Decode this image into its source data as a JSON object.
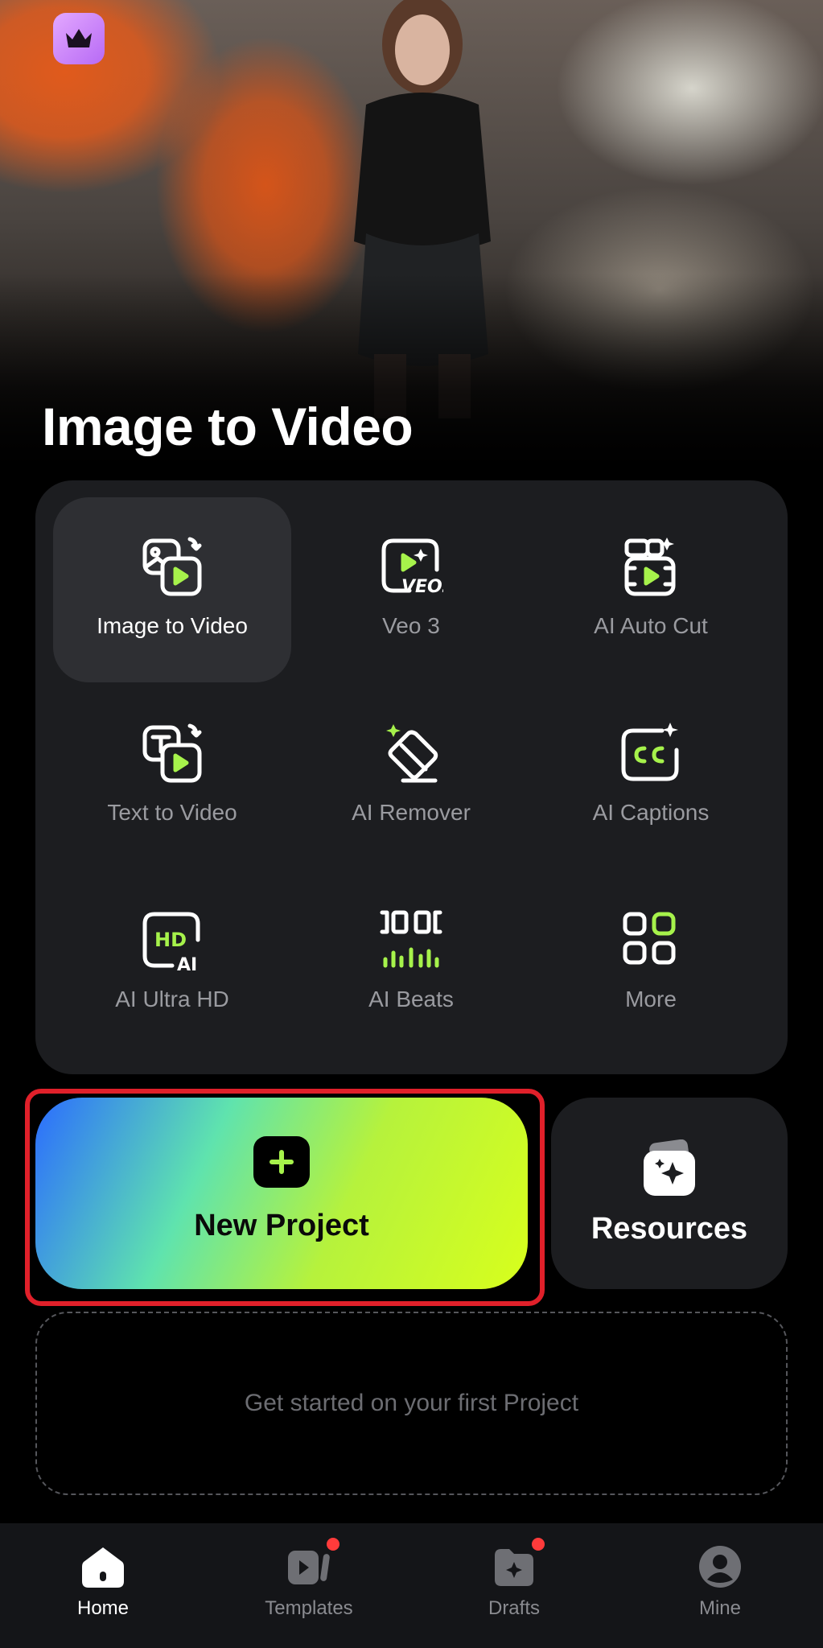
{
  "hero": {
    "title": "Image to Video",
    "premium_icon": "crown-icon"
  },
  "tools": [
    {
      "label": "Image to Video",
      "icon": "image-to-video-icon",
      "active": true
    },
    {
      "label": "Veo 3",
      "icon": "veo3-icon",
      "active": false
    },
    {
      "label": "AI Auto Cut",
      "icon": "auto-cut-icon",
      "active": false
    },
    {
      "label": "Text to Video",
      "icon": "text-to-video-icon",
      "active": false
    },
    {
      "label": "AI Remover",
      "icon": "eraser-icon",
      "active": false
    },
    {
      "label": "AI Captions",
      "icon": "captions-icon",
      "active": false
    },
    {
      "label": "AI Ultra HD",
      "icon": "hd-ai-icon",
      "active": false
    },
    {
      "label": "AI Beats",
      "icon": "beats-icon",
      "active": false
    },
    {
      "label": "More",
      "icon": "grid-icon",
      "active": false
    }
  ],
  "actions": {
    "new_project_label": "New Project",
    "resources_label": "Resources"
  },
  "empty_state": {
    "text": "Get started on your first Project"
  },
  "nav": [
    {
      "label": "Home",
      "icon": "home-icon",
      "active": true,
      "badge": false
    },
    {
      "label": "Templates",
      "icon": "templates-icon",
      "active": false,
      "badge": true
    },
    {
      "label": "Drafts",
      "icon": "drafts-folder-icon",
      "active": false,
      "badge": true
    },
    {
      "label": "Mine",
      "icon": "profile-icon",
      "active": false,
      "badge": false
    }
  ],
  "colors": {
    "accent_green": "#A6F24B",
    "highlight_red": "#E0202A",
    "badge_red": "#FF3B3B",
    "premium_purple": "#C27BF8"
  }
}
